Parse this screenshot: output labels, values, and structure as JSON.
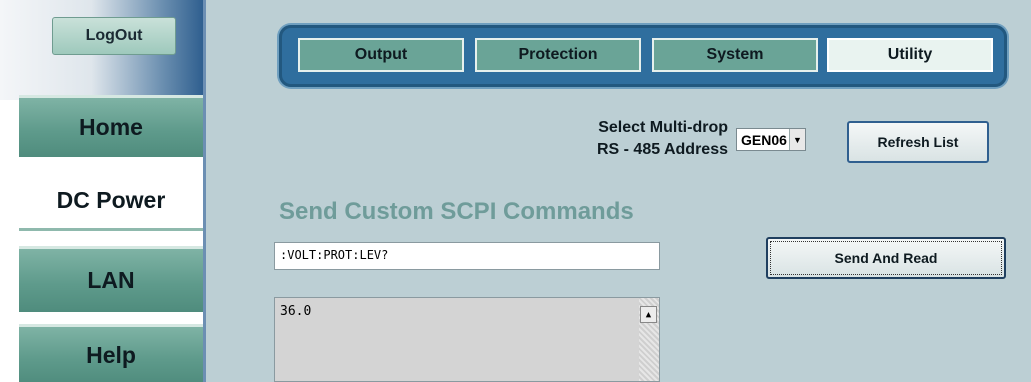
{
  "sidebar": {
    "logout_label": "LogOut",
    "items": [
      {
        "label": "Home"
      },
      {
        "label": "DC Power"
      },
      {
        "label": "LAN"
      },
      {
        "label": "Help"
      }
    ]
  },
  "tabs": [
    {
      "label": "Output"
    },
    {
      "label": "Protection"
    },
    {
      "label": "System"
    },
    {
      "label": "Utility"
    }
  ],
  "multidrop": {
    "label_line1": "Select Multi-drop",
    "label_line2": "RS - 485 Address",
    "selected": "GEN06",
    "refresh_label": "Refresh List"
  },
  "scpi": {
    "title": "Send Custom SCPI Commands",
    "command_value": ":VOLT:PROT:LEV?",
    "send_label": "Send And Read",
    "response": "36.0"
  },
  "icons": {
    "dropdown": "chevron-down-icon",
    "scroll_up": "scroll-up-arrow-icon"
  }
}
